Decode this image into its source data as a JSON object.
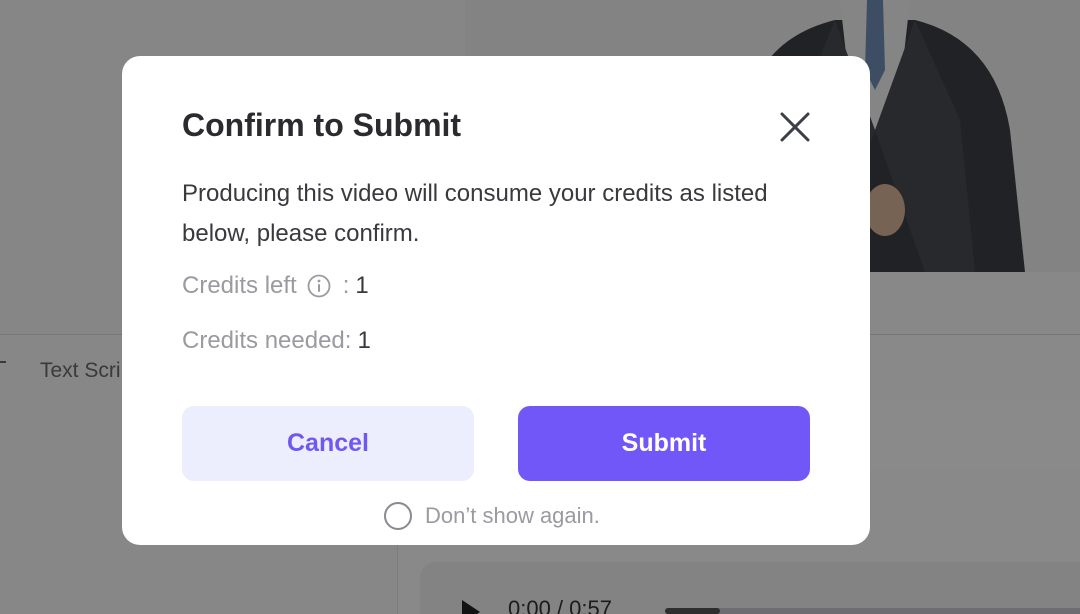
{
  "background": {
    "tab_label": "Text Scri",
    "audio_time": "0:00 / 0:57",
    "audio_progress_fraction": 0.13
  },
  "dialog": {
    "title": "Confirm to Submit",
    "message": "Producing this video will consume your credits as listed below, please confirm.",
    "credits_left_label": "Credits left",
    "credits_left_value": "1",
    "credits_needed_label": "Credits needed:",
    "credits_needed_value": "1",
    "cancel_label": "Cancel",
    "submit_label": "Submit",
    "dont_show_label": "Don’t show again.",
    "dont_show_checked": false
  },
  "icons": {
    "close": "close-icon",
    "info": "info-icon",
    "play": "play-icon"
  },
  "colors": {
    "primary": "#7257f8",
    "cancel_bg": "#ecedfd",
    "cancel_text": "#6f58f2",
    "overlay": "rgba(0,0,0,0.45)"
  }
}
